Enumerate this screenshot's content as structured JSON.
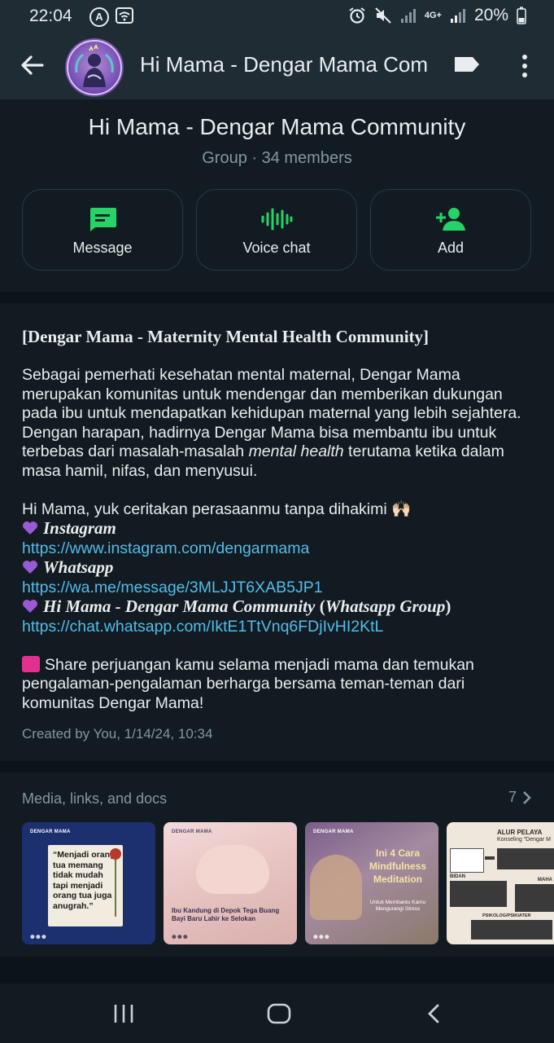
{
  "status_bar": {
    "time": "22:04",
    "battery": "20%",
    "network": "4G+"
  },
  "app_bar": {
    "title": "Hi Mama - Dengar Mama Com"
  },
  "group": {
    "name": "Hi Mama - Dengar Mama Community",
    "meta": "Group · 34 members"
  },
  "actions": [
    {
      "label": "Message",
      "icon": "message-icon"
    },
    {
      "label": "Voice chat",
      "icon": "voice-wave-icon"
    },
    {
      "label": "Add",
      "icon": "add-person-icon"
    }
  ],
  "description": {
    "heading": "[Dengar Mama - Maternity Mental Health Community]",
    "para1_a": "Sebagai pemerhati kesehatan mental maternal, Dengar Mama merupakan komunitas untuk mendengar dan memberikan dukungan pada ibu untuk mendapatkan kehidupan maternal yang lebih sejahtera. Dengan harapan, hadirnya Dengar Mama bisa membantu ibu untuk terbebas dari masalah-masalah ",
    "para1_em": "mental health",
    "para1_b": " terutama ketika dalam masa hamil, nifas, dan menyusui.",
    "invite": "Hi Mama, yuk ceritakan perasaanmu tanpa dihakimi 🙌🏻",
    "ig_label": "Instagram",
    "ig_url": "https://www.instagram.com/dengarmama",
    "wa_label": "Whatsapp",
    "wa_url": "https://wa.me/message/3MLJJT6XAB5JP1",
    "group_label": "Hi Mama - Dengar Mama Community",
    "group_label_paren": "Whatsapp Group",
    "group_url": "https://chat.whatsapp.com/IktE1TtVnq6FDjIvHI2KtL",
    "share": "Share perjuangan kamu selama menjadi mama dan temukan pengalaman-pengalaman berharga bersama teman-teman dari komunitas Dengar Mama!",
    "created": "Created by You, 1/14/24, 10:34"
  },
  "media": {
    "title": "Media, links, and docs",
    "count": "7",
    "thumbs": [
      {
        "brand": "DENGAR MAMA",
        "text": "“Menjadi orang tua memang tidak mudah tapi menjadi orang tua juga anugrah.”",
        "bg": "#1c2f6e"
      },
      {
        "brand": "DENGAR MAMA",
        "text": "Ibu Kandung di Depok Tega Buang Bayi Baru Lahir ke Selokan",
        "bg": "#e9c9c6"
      },
      {
        "brand": "DENGAR MAMA",
        "title": "Ini 4 Cara Mindfulness Meditation",
        "sub": "Untuk Membantu Kamu Mengurangi Stress",
        "bg": "#6f5b7f"
      },
      {
        "title": "ALUR PELAYA",
        "sub": "Konseling \"Dengar M",
        "b1": "BIDAN",
        "b2": "MAHA",
        "b3": "PSIKOLOG/PSIKIATER",
        "bg": "#efe6dc"
      }
    ]
  },
  "colors": {
    "accent": "#25d366",
    "link": "#53bdeb",
    "background": "#0b141a",
    "card": "#111b21"
  }
}
